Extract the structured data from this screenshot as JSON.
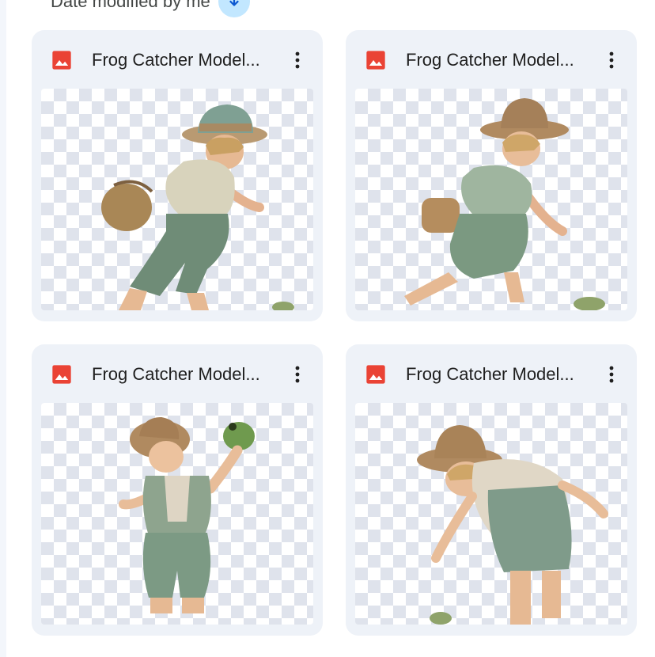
{
  "toolbar": {
    "sort_label": "Date modified by me",
    "sort_direction_icon": "arrow-down-icon"
  },
  "files": [
    {
      "name": "Frog Catcher Model...",
      "type": "image",
      "icon": "image-file-icon",
      "icon_color": "#ea4335"
    },
    {
      "name": "Frog Catcher Model...",
      "type": "image",
      "icon": "image-file-icon",
      "icon_color": "#ea4335"
    },
    {
      "name": "Frog Catcher Model...",
      "type": "image",
      "icon": "image-file-icon",
      "icon_color": "#ea4335"
    },
    {
      "name": "Frog Catcher Model...",
      "type": "image",
      "icon": "image-file-icon",
      "icon_color": "#ea4335"
    }
  ],
  "colors": {
    "card_bg": "#eef2f8",
    "sort_button_bg": "#c2e7ff",
    "accent": "#0b57d0"
  }
}
